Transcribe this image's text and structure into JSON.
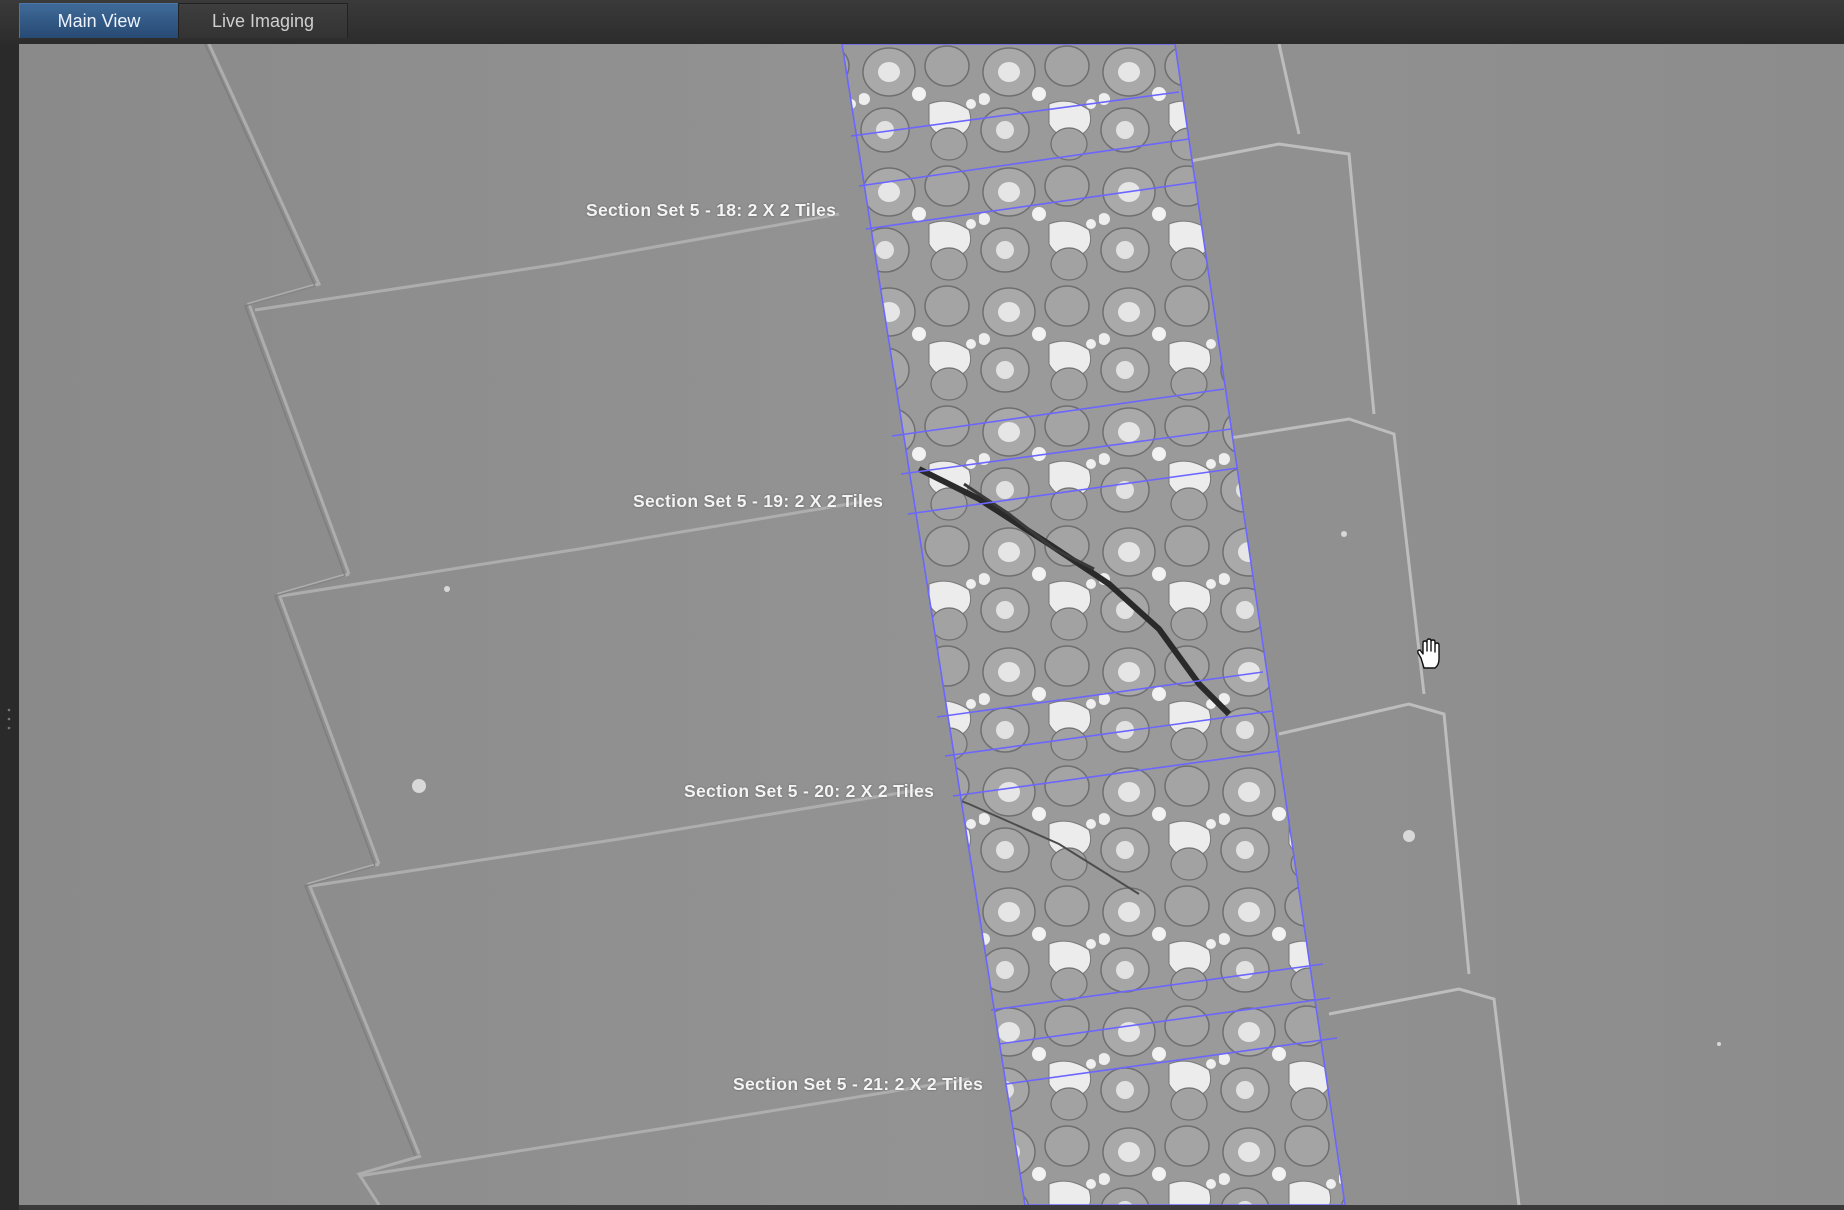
{
  "tabs": [
    {
      "label": "Main View",
      "active": true
    },
    {
      "label": "Live Imaging",
      "active": false
    }
  ],
  "viewer": {
    "sections": [
      {
        "label": "Section Set 5 - 18: 2 X 2 Tiles"
      },
      {
        "label": "Section Set 5 - 19: 2 X 2 Tiles"
      },
      {
        "label": "Section Set 5 - 20: 2 X 2 Tiles"
      },
      {
        "label": "Section Set 5 - 21: 2 X 2 Tiles"
      }
    ],
    "tile_outline_color": "#6b66ff",
    "cursor_icon": "hand-pan-icon"
  }
}
